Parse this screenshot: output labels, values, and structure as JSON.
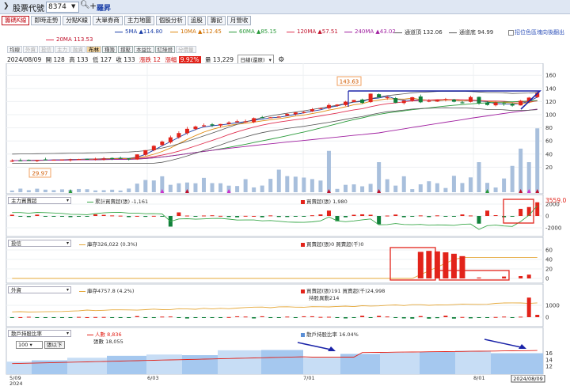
{
  "topbar": {
    "title": "股票代號",
    "code_value": "8374",
    "stock_name": "羅昇"
  },
  "tabs": [
    "籌碼K線",
    "即時走勢",
    "分點K線",
    "大單券商",
    "主力地圖",
    "個股分析",
    "追股",
    "籌記",
    "月營收"
  ],
  "ma_legend": {
    "ma20": "20MA 113.53",
    "ma5": "5MA ▲114.80",
    "ma10": "10MA ▲112.45",
    "ma60": "60MA ▲85.15",
    "ma120": "120MA ▲57.51",
    "ma240": "240MA ▲43.02",
    "band_upper": "通道頂 132.06",
    "band_lower": "通道底 94.99",
    "settings": "招位色區塊向後翻出"
  },
  "subtabs": [
    "均線",
    "外資",
    "投信",
    "主力",
    "融資",
    "布林",
    "種籌",
    "撐壓",
    "本益比",
    "紅綠燈",
    "分價量"
  ],
  "quote": {
    "date": "2024/08/09",
    "open": "開 128",
    "high": "高 133",
    "low": "低 127",
    "close": "收 133",
    "change": "漲跌 12",
    "pct_label": "漲幅",
    "pct": "9.92%",
    "volume": "量 13,229",
    "period": "日線(還原)"
  },
  "main_chart": {
    "y_ticks": [
      "160",
      "140",
      "120",
      "100",
      "80",
      "60",
      "40",
      "20"
    ],
    "high_label": "143.63",
    "low_label": "29.97"
  },
  "panel_main_force": {
    "label": "主力買賣超",
    "legend_line": "累計買賣超(張) -1,161",
    "legend_bar": "買賣超(張) 1,980",
    "value": "3559.0",
    "y_ticks": [
      "2000",
      "0",
      "-2000"
    ]
  },
  "panel_trust": {
    "label": "投信",
    "legend_line": "庫存326,022 (0.3%)",
    "legend_bar": "買賣超(張)0 買賣超(千)0",
    "y_ticks": [
      "60",
      "40",
      "20",
      "0"
    ]
  },
  "panel_foreign": {
    "label": "外資",
    "legend_line": "庫存4757.8 (4.2%)",
    "legend_bar": "買賣超(張)191 買賣超(千)24,998",
    "legend_sub": "持股異動214",
    "y_ticks": [
      "1000",
      "0"
    ]
  },
  "panel_holders": {
    "label": "散戶持股比率",
    "legend_people": "人數 8,836",
    "legend_shares": "張數 18,055",
    "legend_ratio": "散戶持股比率 16.04%",
    "qty": "100",
    "qty_btn": "張以下",
    "y_ticks": [
      "16",
      "14",
      "12"
    ]
  },
  "x_axis": {
    "labels": [
      "5/09",
      "6/03",
      "7/01",
      "8/01"
    ],
    "year": "2024",
    "current": "2024/08/09"
  },
  "colors": {
    "up": "#e2231a",
    "down": "#10803a",
    "volume": "#9fb8d6",
    "accent": "#1b3fa8"
  }
}
